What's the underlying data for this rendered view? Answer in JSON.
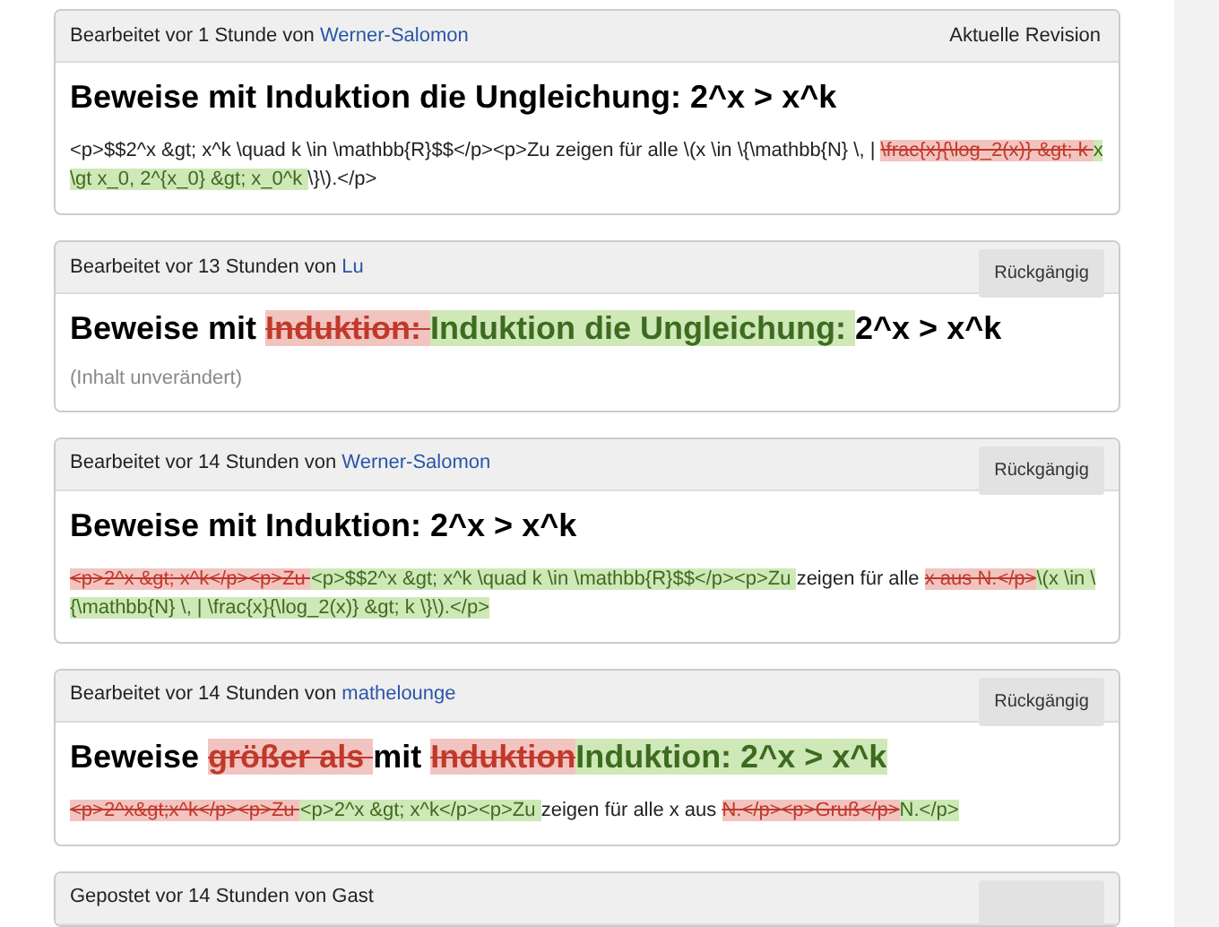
{
  "revisions": [
    {
      "header": {
        "text": "Bearbeitet vor 1 Stunde von",
        "author": "Werner-Salomon",
        "action": {
          "kind": "label",
          "label": "Aktuelle Revision"
        }
      },
      "title": [
        {
          "kind": "same",
          "text": "Beweise mit Induktion die Ungleichung: 2^x > x^k"
        }
      ],
      "body": [
        {
          "kind": "same",
          "text": "<p>$$2^x &gt; x^k \\quad k \\in \\mathbb{R}$$</p><p>Zu zeigen für alle \\(x \\in \\{\\mathbb{N} \\, | "
        },
        {
          "kind": "del",
          "text": "\\frac{x}{\\log_2(x)} &gt; k "
        },
        {
          "kind": "ins",
          "text": "x \\gt x_0, 2^{x_0} &gt; x_0^k "
        },
        {
          "kind": "same",
          "text": "\\}\\).</p>"
        }
      ]
    },
    {
      "header": {
        "text": "Bearbeitet vor 13 Stunden von",
        "author": "Lu",
        "action": {
          "kind": "button",
          "label": "Rückgängig"
        }
      },
      "title": [
        {
          "kind": "same",
          "text": "Beweise mit "
        },
        {
          "kind": "del",
          "text": "Induktion: "
        },
        {
          "kind": "ins",
          "text": "Induktion die Ungleichung: "
        },
        {
          "kind": "same",
          "text": "2^x > x^k"
        }
      ],
      "note": "(Inhalt unverändert)"
    },
    {
      "header": {
        "text": "Bearbeitet vor 14 Stunden von",
        "author": "Werner-Salomon",
        "action": {
          "kind": "button",
          "label": "Rückgängig"
        }
      },
      "title": [
        {
          "kind": "same",
          "text": "Beweise mit Induktion: 2^x > x^k"
        }
      ],
      "body": [
        {
          "kind": "del",
          "text": "<p>2^x &gt; x^k</p><p>Zu "
        },
        {
          "kind": "ins",
          "text": "<p>$$2^x &gt; x^k \\quad k \\in \\mathbb{R}$$</p><p>Zu "
        },
        {
          "kind": "same",
          "text": "zeigen für alle "
        },
        {
          "kind": "del",
          "text": "x aus N.</p>"
        },
        {
          "kind": "ins",
          "text": "\\(x \\in \\{\\mathbb{N} \\, | \\frac{x}{\\log_2(x)} &gt; k \\}\\).</p>"
        }
      ]
    },
    {
      "header": {
        "text": "Bearbeitet vor 14 Stunden von",
        "author": "mathelounge",
        "action": {
          "kind": "button",
          "label": "Rückgängig"
        }
      },
      "title": [
        {
          "kind": "same",
          "text": "Beweise "
        },
        {
          "kind": "del",
          "text": "größer als "
        },
        {
          "kind": "same",
          "text": "mit "
        },
        {
          "kind": "del",
          "text": "Induktion"
        },
        {
          "kind": "ins",
          "text": "Induktion: 2^x > x^k"
        }
      ],
      "body": [
        {
          "kind": "del",
          "text": "<p>2^x&gt;x^k</p><p>Zu "
        },
        {
          "kind": "ins",
          "text": "<p>2^x &gt; x^k</p><p>Zu "
        },
        {
          "kind": "same",
          "text": "zeigen für alle x aus "
        },
        {
          "kind": "del",
          "text": "N.</p><p>Gruß</p>"
        },
        {
          "kind": "ins",
          "text": "N.</p>"
        }
      ]
    },
    {
      "header": {
        "text": "Gepostet vor 14 Stunden von Gast",
        "action": {
          "kind": "button"
        }
      }
    }
  ]
}
